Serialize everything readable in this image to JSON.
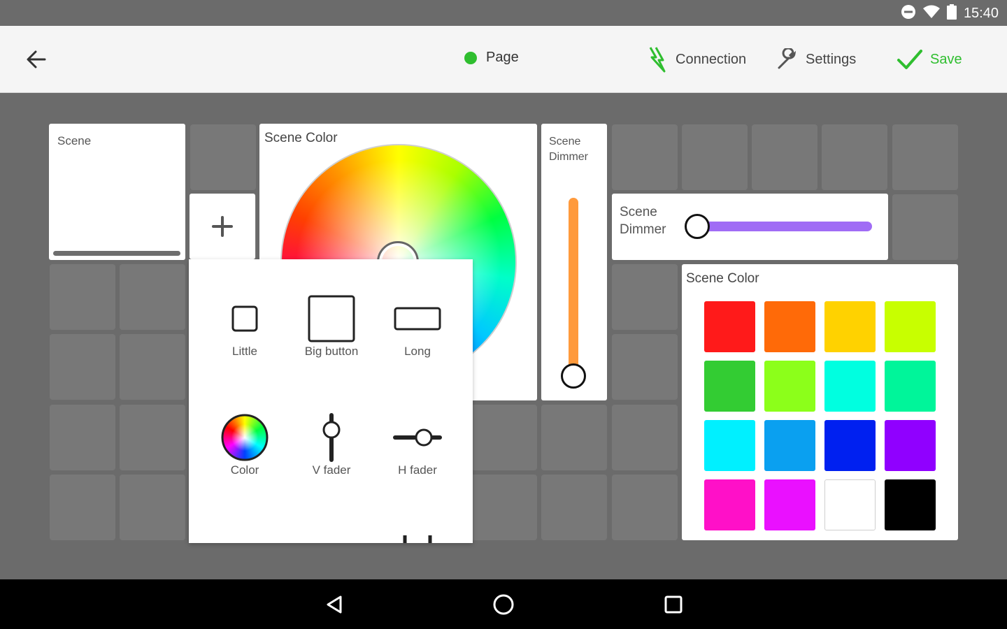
{
  "status_bar": {
    "time": "15:40"
  },
  "app_bar": {
    "page_label": "Page",
    "page_dot_color": "#2fbe2f",
    "connection_label": "Connection",
    "settings_label": "Settings",
    "save_label": "Save",
    "accent_color": "#2fbe2f"
  },
  "tiles": {
    "scene_button_label": "Scene",
    "scene_color_label": "Scene Color",
    "scene_dimmer_v_label": "Scene Dimmer",
    "scene_dimmer_h_label": "Scene Dimmer",
    "scene_palette_label": "Scene Color",
    "v_dimmer_level": 0.0,
    "h_dimmer_level": 0.0,
    "v_dimmer_color": "#ff9a3c",
    "h_dimmer_color": "#a06cf5"
  },
  "add_widget": {
    "icon": "plus-icon"
  },
  "widget_picker": {
    "items": [
      {
        "label": "Little",
        "icon": "little-button-icon"
      },
      {
        "label": "Big button",
        "icon": "big-button-icon"
      },
      {
        "label": "Long",
        "icon": "long-button-icon"
      },
      {
        "label": "Color",
        "icon": "color-wheel-icon"
      },
      {
        "label": "V fader",
        "icon": "v-fader-icon"
      },
      {
        "label": "H fader",
        "icon": "h-fader-icon"
      }
    ]
  },
  "palette": {
    "colors": [
      "#ff1a1a",
      "#ff6a08",
      "#ffd200",
      "#c8ff00",
      "#33cc33",
      "#8cff1a",
      "#00ffe0",
      "#00f59a",
      "#00f0ff",
      "#0aa0f0",
      "#0020f0",
      "#9000ff",
      "#ff10c8",
      "#ea10ff",
      "#ffffff",
      "#000000"
    ]
  }
}
